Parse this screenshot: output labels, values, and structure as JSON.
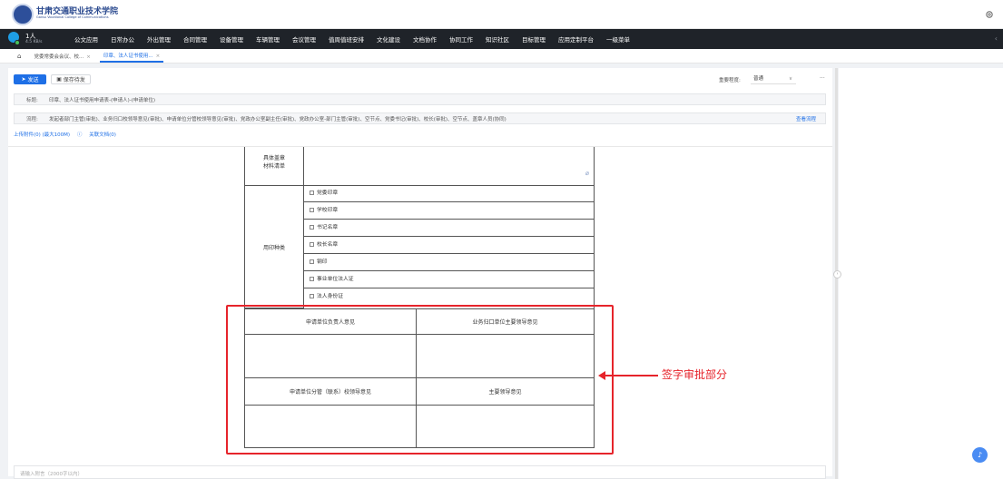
{
  "header": {
    "logo_text": "甘肃交通职业技术学院",
    "logo_subtext": "Gansu Vocational College of Communications"
  },
  "user": {
    "name": "1人",
    "speed": "4.5 KB/s"
  },
  "nav": {
    "items": [
      "公文应用",
      "日常办公",
      "外出管理",
      "合同管理",
      "设备管理",
      "车辆管理",
      "会议管理",
      "值周值班安排",
      "文化建设",
      "文档协作",
      "协同工作",
      "知识社区",
      "目标管理",
      "应用定制平台",
      "一级菜单"
    ]
  },
  "tabs": [
    {
      "label": "党委常委会会议、校...",
      "close": "×",
      "active": false
    },
    {
      "label": "印章、法人证书使用...",
      "close": "× ",
      "active": true
    }
  ],
  "toolbar": {
    "send": "发送",
    "save": "保存待发",
    "priority_label": "重要程度:",
    "priority_value": "普通",
    "more": "···"
  },
  "fields": {
    "title_label": "标题:",
    "title_value": "印章、法人证书使用申请表-(申请人)-(申请单位)",
    "flow_label": "流程:",
    "flow_value": "发起者部门主管(审批)、业务归口校领导意见(审批)、申请单位分管校领导意见(审批)、党政办公室副主任(审批)、党政办公室-部门主管(审批)、空节点、党委书记(审批)、校长(审批)、空节点、盖章人员(协同)",
    "flow_link": "查看流程"
  },
  "attachments": {
    "upload": "上传附件(0) (最大100M)",
    "related": "关联文档(0)"
  },
  "form": {
    "material_label": "具体盖章材料清单",
    "seal_type_label": "用印种类",
    "seal_options": [
      "党委印章",
      "学校印章",
      "书记名章",
      "校长名章",
      "钢印",
      "事业单位法人证",
      "法人身份证"
    ],
    "approval_1": "申请单位负责人意见",
    "approval_2": "业务归口单位主要领导意见",
    "approval_3": "申请单位分管（联系）校领导意见",
    "approval_4": "主要领导意见"
  },
  "annotation": {
    "text": "签字审批部分",
    "color": "#e6242b"
  },
  "comment": {
    "placeholder": "请输入附言（2000字以内）"
  },
  "colors": {
    "primary": "#1e6fe6",
    "navbar": "#1f2329",
    "highlight": "#e6242b"
  }
}
